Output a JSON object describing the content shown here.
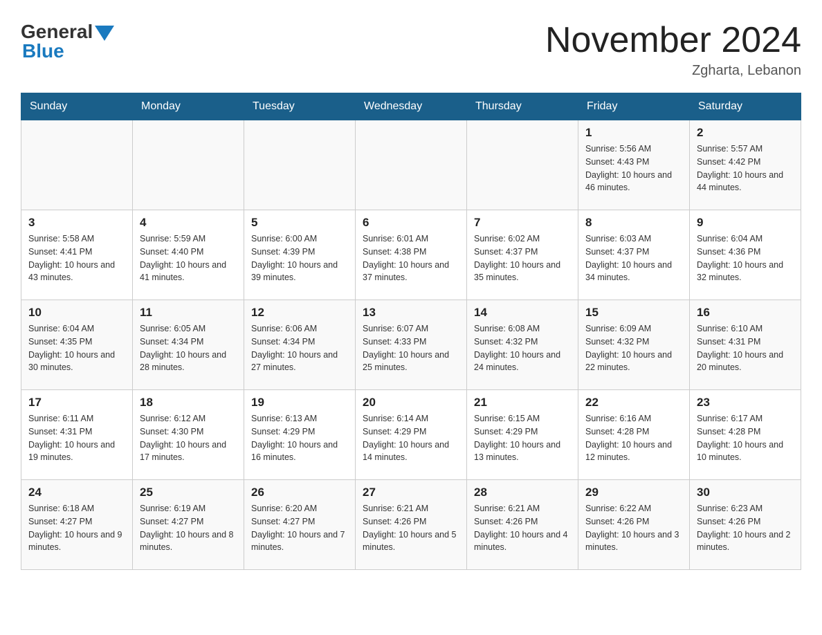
{
  "header": {
    "logo_general": "General",
    "logo_blue": "Blue",
    "month_title": "November 2024",
    "subtitle": "Zgharta, Lebanon"
  },
  "days_of_week": [
    "Sunday",
    "Monday",
    "Tuesday",
    "Wednesday",
    "Thursday",
    "Friday",
    "Saturday"
  ],
  "weeks": [
    [
      {
        "day": "",
        "info": ""
      },
      {
        "day": "",
        "info": ""
      },
      {
        "day": "",
        "info": ""
      },
      {
        "day": "",
        "info": ""
      },
      {
        "day": "",
        "info": ""
      },
      {
        "day": "1",
        "info": "Sunrise: 5:56 AM\nSunset: 4:43 PM\nDaylight: 10 hours and 46 minutes."
      },
      {
        "day": "2",
        "info": "Sunrise: 5:57 AM\nSunset: 4:42 PM\nDaylight: 10 hours and 44 minutes."
      }
    ],
    [
      {
        "day": "3",
        "info": "Sunrise: 5:58 AM\nSunset: 4:41 PM\nDaylight: 10 hours and 43 minutes."
      },
      {
        "day": "4",
        "info": "Sunrise: 5:59 AM\nSunset: 4:40 PM\nDaylight: 10 hours and 41 minutes."
      },
      {
        "day": "5",
        "info": "Sunrise: 6:00 AM\nSunset: 4:39 PM\nDaylight: 10 hours and 39 minutes."
      },
      {
        "day": "6",
        "info": "Sunrise: 6:01 AM\nSunset: 4:38 PM\nDaylight: 10 hours and 37 minutes."
      },
      {
        "day": "7",
        "info": "Sunrise: 6:02 AM\nSunset: 4:37 PM\nDaylight: 10 hours and 35 minutes."
      },
      {
        "day": "8",
        "info": "Sunrise: 6:03 AM\nSunset: 4:37 PM\nDaylight: 10 hours and 34 minutes."
      },
      {
        "day": "9",
        "info": "Sunrise: 6:04 AM\nSunset: 4:36 PM\nDaylight: 10 hours and 32 minutes."
      }
    ],
    [
      {
        "day": "10",
        "info": "Sunrise: 6:04 AM\nSunset: 4:35 PM\nDaylight: 10 hours and 30 minutes."
      },
      {
        "day": "11",
        "info": "Sunrise: 6:05 AM\nSunset: 4:34 PM\nDaylight: 10 hours and 28 minutes."
      },
      {
        "day": "12",
        "info": "Sunrise: 6:06 AM\nSunset: 4:34 PM\nDaylight: 10 hours and 27 minutes."
      },
      {
        "day": "13",
        "info": "Sunrise: 6:07 AM\nSunset: 4:33 PM\nDaylight: 10 hours and 25 minutes."
      },
      {
        "day": "14",
        "info": "Sunrise: 6:08 AM\nSunset: 4:32 PM\nDaylight: 10 hours and 24 minutes."
      },
      {
        "day": "15",
        "info": "Sunrise: 6:09 AM\nSunset: 4:32 PM\nDaylight: 10 hours and 22 minutes."
      },
      {
        "day": "16",
        "info": "Sunrise: 6:10 AM\nSunset: 4:31 PM\nDaylight: 10 hours and 20 minutes."
      }
    ],
    [
      {
        "day": "17",
        "info": "Sunrise: 6:11 AM\nSunset: 4:31 PM\nDaylight: 10 hours and 19 minutes."
      },
      {
        "day": "18",
        "info": "Sunrise: 6:12 AM\nSunset: 4:30 PM\nDaylight: 10 hours and 17 minutes."
      },
      {
        "day": "19",
        "info": "Sunrise: 6:13 AM\nSunset: 4:29 PM\nDaylight: 10 hours and 16 minutes."
      },
      {
        "day": "20",
        "info": "Sunrise: 6:14 AM\nSunset: 4:29 PM\nDaylight: 10 hours and 14 minutes."
      },
      {
        "day": "21",
        "info": "Sunrise: 6:15 AM\nSunset: 4:29 PM\nDaylight: 10 hours and 13 minutes."
      },
      {
        "day": "22",
        "info": "Sunrise: 6:16 AM\nSunset: 4:28 PM\nDaylight: 10 hours and 12 minutes."
      },
      {
        "day": "23",
        "info": "Sunrise: 6:17 AM\nSunset: 4:28 PM\nDaylight: 10 hours and 10 minutes."
      }
    ],
    [
      {
        "day": "24",
        "info": "Sunrise: 6:18 AM\nSunset: 4:27 PM\nDaylight: 10 hours and 9 minutes."
      },
      {
        "day": "25",
        "info": "Sunrise: 6:19 AM\nSunset: 4:27 PM\nDaylight: 10 hours and 8 minutes."
      },
      {
        "day": "26",
        "info": "Sunrise: 6:20 AM\nSunset: 4:27 PM\nDaylight: 10 hours and 7 minutes."
      },
      {
        "day": "27",
        "info": "Sunrise: 6:21 AM\nSunset: 4:26 PM\nDaylight: 10 hours and 5 minutes."
      },
      {
        "day": "28",
        "info": "Sunrise: 6:21 AM\nSunset: 4:26 PM\nDaylight: 10 hours and 4 minutes."
      },
      {
        "day": "29",
        "info": "Sunrise: 6:22 AM\nSunset: 4:26 PM\nDaylight: 10 hours and 3 minutes."
      },
      {
        "day": "30",
        "info": "Sunrise: 6:23 AM\nSunset: 4:26 PM\nDaylight: 10 hours and 2 minutes."
      }
    ]
  ]
}
